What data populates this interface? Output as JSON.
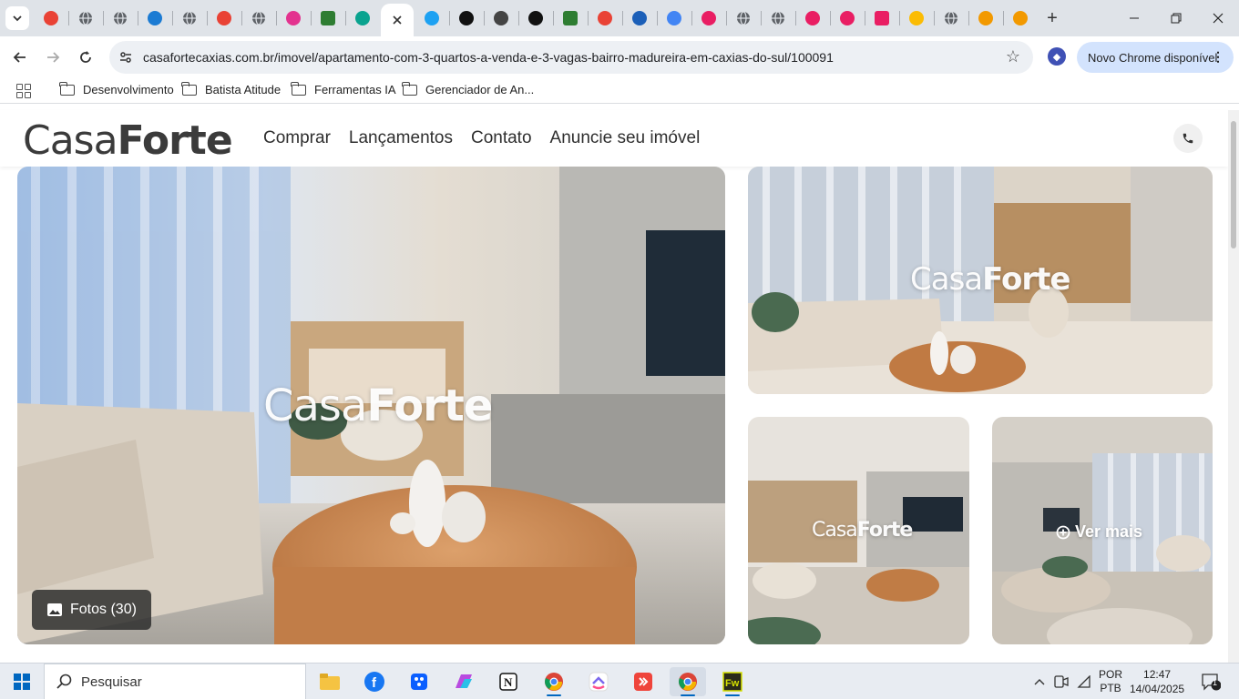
{
  "browser": {
    "tabs": [
      {
        "icon": "dots-app-icon",
        "color": "#e94235"
      },
      {
        "icon": "globe-icon",
        "color": "#5f6368"
      },
      {
        "icon": "globe-icon",
        "color": "#5f6368"
      },
      {
        "icon": "edge-icon",
        "color": "#1b7bd3"
      },
      {
        "icon": "globe-icon",
        "color": "#5f6368"
      },
      {
        "icon": "flame-icon",
        "color": "#e94235"
      },
      {
        "icon": "globe-icon",
        "color": "#5f6368"
      },
      {
        "icon": "m-icon",
        "color": "#e3338f"
      },
      {
        "icon": "leaf-icon",
        "color": "#2e7d32"
      },
      {
        "icon": "hexagon-icon",
        "color": "#0aa38f"
      },
      {
        "icon": "close-icon",
        "color": "#333333",
        "active": true
      },
      {
        "icon": "bird-icon",
        "color": "#1da1f2"
      },
      {
        "icon": "eye-icon",
        "color": "#111111"
      },
      {
        "icon": "robot-icon",
        "color": "#444444"
      },
      {
        "icon": "triangle-icon",
        "color": "#111111"
      },
      {
        "icon": "stack-icon",
        "color": "#2e7d32"
      },
      {
        "icon": "fox-icon",
        "color": "#e94235"
      },
      {
        "icon": "circle-icon",
        "color": "#1b5fb8"
      },
      {
        "icon": "google-icon",
        "color": "#4285f4"
      },
      {
        "icon": "k-icon",
        "color": "#e91e63"
      },
      {
        "icon": "globe-icon",
        "color": "#5f6368"
      },
      {
        "icon": "globe-icon",
        "color": "#5f6368"
      },
      {
        "icon": "k-icon",
        "color": "#e91e63"
      },
      {
        "icon": "k-icon",
        "color": "#e91e63"
      },
      {
        "icon": "k-square-icon",
        "color": "#e91e63"
      },
      {
        "icon": "pinwheel-icon",
        "color": "#fbbc04"
      },
      {
        "icon": "globe-icon",
        "color": "#5f6368"
      },
      {
        "icon": "crown-icon",
        "color": "#f29900"
      },
      {
        "icon": "crown-icon",
        "color": "#f29900"
      }
    ],
    "url": "casafortecaxias.com.br/imovel/apartamento-com-3-quartos-a-venda-e-3-vagas-bairro-madureira-em-caxias-do-sul/100091",
    "update_label": "Novo Chrome disponível",
    "bookmarks": [
      "Desenvolvimento",
      "Batista Atitude",
      "Ferramentas IA",
      "Gerenciador de An..."
    ]
  },
  "site": {
    "logo_light": "Casa",
    "logo_bold": "Forte",
    "nav": [
      "Comprar",
      "Lançamentos",
      "Contato",
      "Anuncie seu imóvel"
    ],
    "phone_icon": "phone-icon"
  },
  "gallery": {
    "watermark_light": "Casa",
    "watermark_bold": "Forte",
    "photos_button": "Fotos (30)",
    "see_more": "Ver mais"
  },
  "taskbar": {
    "search_placeholder": "Pesquisar",
    "language": "POR",
    "keyboard": "PTB",
    "time": "12:47",
    "date": "14/04/2025",
    "notifications": "1"
  }
}
